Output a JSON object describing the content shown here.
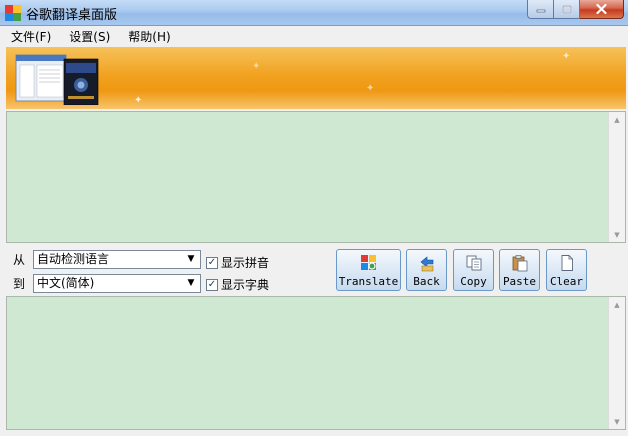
{
  "window": {
    "title": "谷歌翻译桌面版"
  },
  "menu": [
    {
      "label": "文件(F)"
    },
    {
      "label": "设置(S)"
    },
    {
      "label": "帮助(H)"
    }
  ],
  "controls": {
    "from_label": "从",
    "to_label": "到",
    "from_lang": "自动检测语言",
    "to_lang": "中文(简体)",
    "show_pinyin": {
      "label": "显示拼音",
      "checked": true
    },
    "show_dict": {
      "label": "显示字典",
      "checked": true
    }
  },
  "buttons": {
    "translate": "Translate",
    "back": "Back",
    "copy": "Copy",
    "paste": "Paste",
    "clear": "Clear"
  },
  "source_text": "",
  "result_text": "",
  "colors": {
    "text_area_bg": "#cfe8d2",
    "banner_orange": "#f1a220",
    "button_border": "#6a99c8"
  }
}
